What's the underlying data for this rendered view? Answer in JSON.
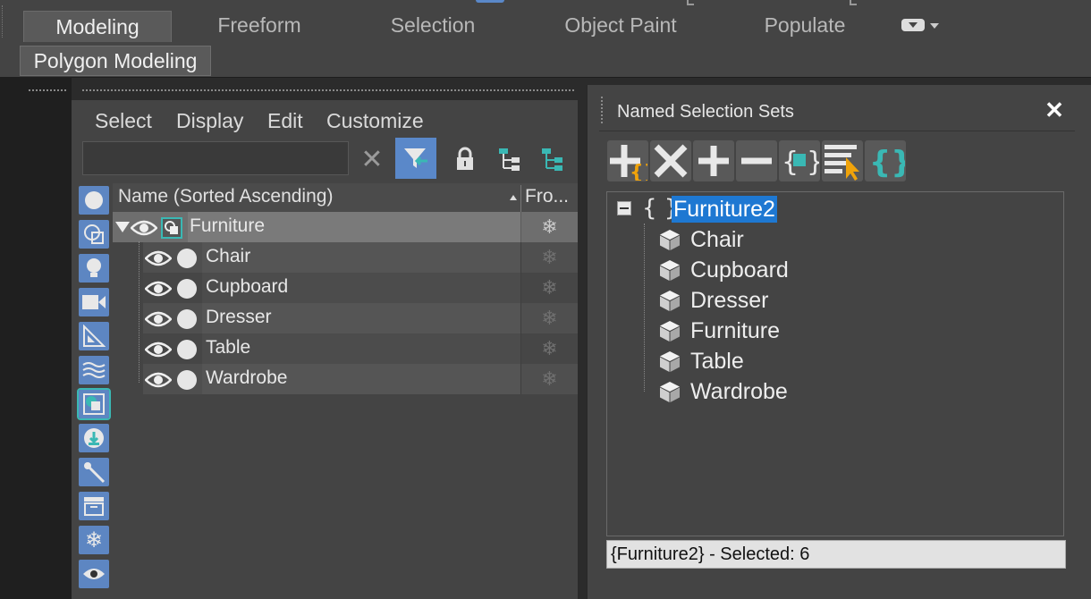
{
  "ribbon": {
    "tabs": [
      "Modeling",
      "Freeform",
      "Selection",
      "Object Paint",
      "Populate"
    ],
    "active_tab": "Modeling",
    "sub_label": "Polygon Modeling"
  },
  "scene_explorer": {
    "menu": [
      "Select",
      "Display",
      "Edit",
      "Customize"
    ],
    "search": {
      "value": "",
      "placeholder": ""
    },
    "columns": {
      "name": "Name (Sorted Ascending)",
      "frozen": "Fro..."
    },
    "parent": {
      "name": "Furniture"
    },
    "children": [
      {
        "name": "Chair"
      },
      {
        "name": "Cupboard"
      },
      {
        "name": "Dresser"
      },
      {
        "name": "Table"
      },
      {
        "name": "Wardrobe"
      }
    ]
  },
  "named_selection_sets": {
    "title": "Named Selection Sets",
    "set": {
      "braces": "{ }",
      "name": "Furniture2"
    },
    "members": [
      "Chair",
      "Cupboard",
      "Dresser",
      "Furniture",
      "Table",
      "Wardrobe"
    ],
    "status": "{Furniture2} - Selected: 6"
  },
  "colors": {
    "accent": "#5a88c9",
    "selection": "#1e78d2",
    "highlight": "#f0a30a",
    "teal": "#3ab8b4"
  },
  "icons": [
    "close-icon",
    "filter-icon",
    "lock-icon",
    "hierarchy-icon",
    "eye-icon",
    "snowflake-icon",
    "cube-icon"
  ]
}
